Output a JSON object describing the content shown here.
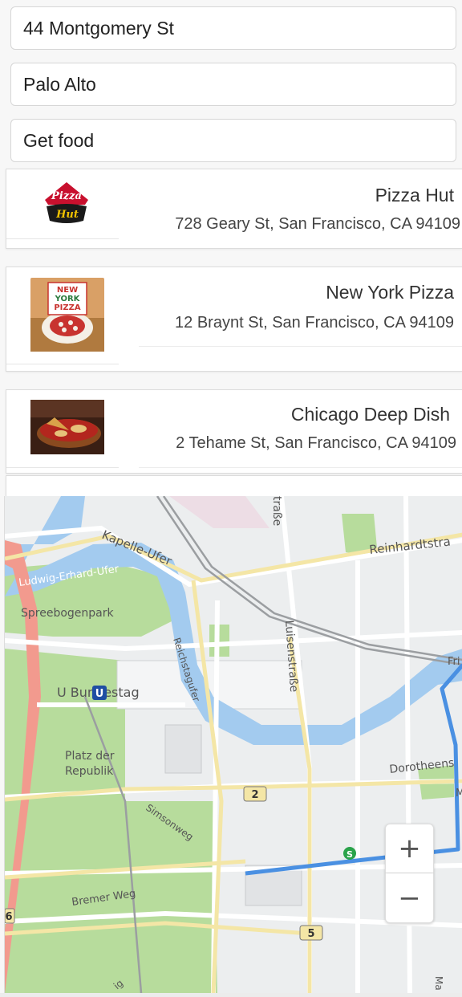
{
  "form": {
    "address": "44 Montgomery St",
    "city": "Palo Alto",
    "action": "Get food"
  },
  "results": [
    {
      "name": "Pizza Hut",
      "address": "728 Geary St, San Francisco, CA 94109",
      "logo": "pizza-hut-logo",
      "logo_text": [
        "Pizza",
        "Hut"
      ]
    },
    {
      "name": "New York Pizza",
      "address": "12 Braynt St, San Francisco, CA 94109",
      "logo": "new-york-pizza-logo",
      "logo_text": [
        "NEW",
        "YORK",
        "PIZZA"
      ]
    },
    {
      "name": "Chicago Deep Dish",
      "address": "2 Tehame St, San Francisco, CA 94109",
      "logo": "deep-dish-photo"
    }
  ],
  "map": {
    "labels": {
      "kapelle": "Kapelle-Ufer",
      "reinhardt": "Reinhardtstra",
      "ludwig": "Ludwig-Erhard-Ufer",
      "spreebogen": "Spreebogenpark",
      "reichstag": "Reichstagufer",
      "luisen": "Luisenstraße",
      "strasse_top": "traße",
      "fri": "Fri",
      "bundestag": "U Bundestag",
      "u_station": "U",
      "platz1": "Platz der",
      "platz2": "Republik",
      "dorothee": "Dorotheens",
      "m": "M",
      "simson": "Simsonweg",
      "bremer": "Bremer Weg",
      "s_station": "S",
      "road2": "2",
      "road5": "5",
      "road6": "6",
      "ma": "Ma",
      "bottom_ig": "ig"
    },
    "route_color": "#4a90e2",
    "water_color": "#a3cbef",
    "park_color": "#b7dc9c",
    "zoom_in": "+",
    "zoom_out": "−"
  }
}
